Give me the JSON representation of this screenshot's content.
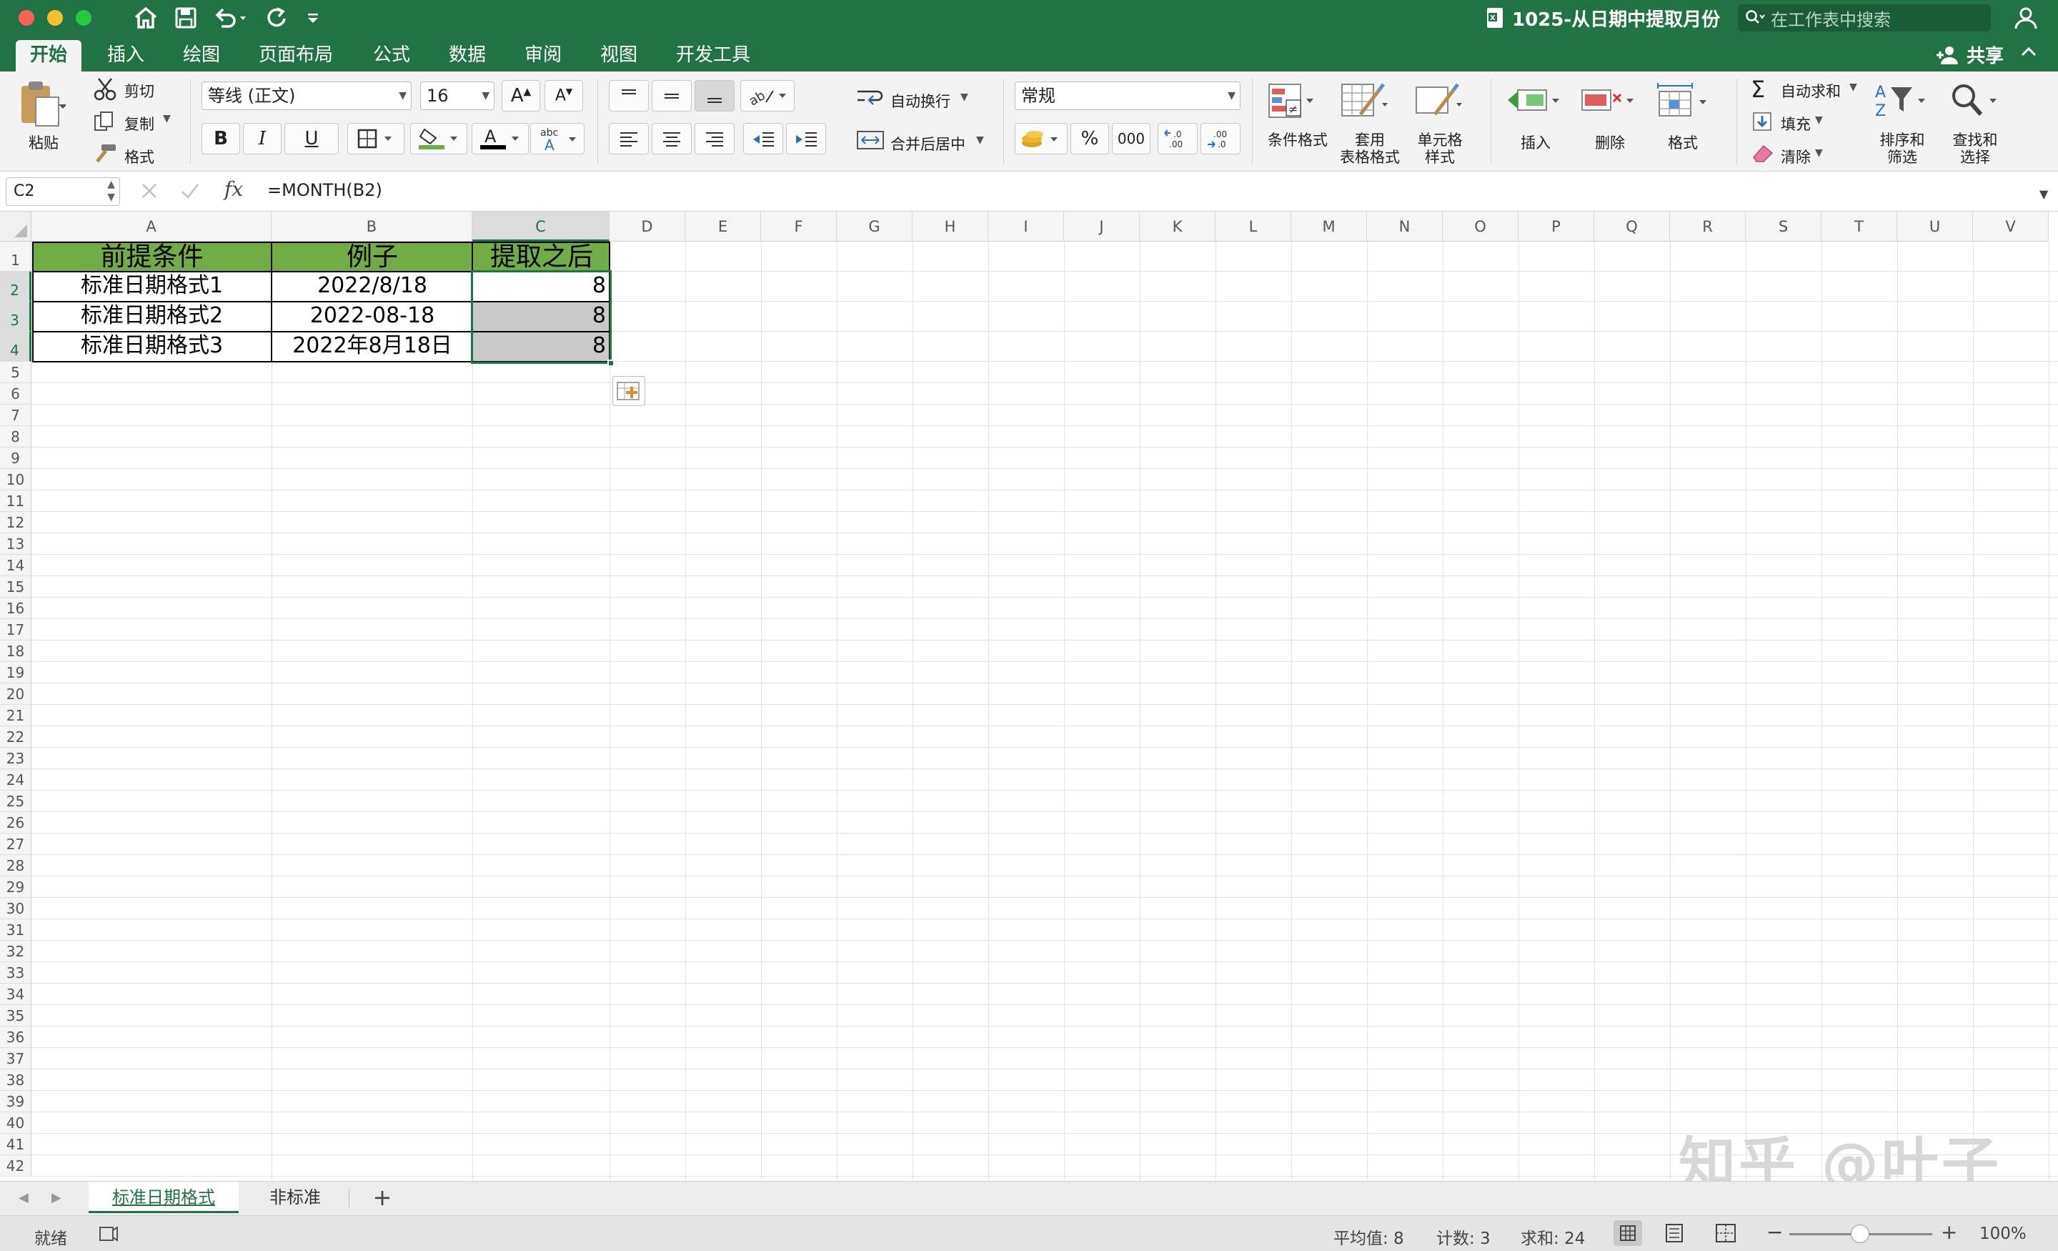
{
  "window": {
    "title": "1025-从日期中提取月份",
    "search_placeholder": "在工作表中搜索",
    "share": "共享"
  },
  "colors": {
    "brand": "#217346",
    "header_fill": "#70ad47",
    "selection": "#217346"
  },
  "ribbon_tabs": [
    "开始",
    "插入",
    "绘图",
    "页面布局",
    "公式",
    "数据",
    "审阅",
    "视图",
    "开发工具"
  ],
  "ribbon": {
    "paste": "粘贴",
    "cut": "剪切",
    "copy": "复制",
    "format_painter": "格式",
    "font_name": "等线 (正文)",
    "font_size": "16",
    "bold": "B",
    "italic": "I",
    "underline": "U",
    "wrap_text": "自动换行",
    "merge_center": "合并后居中",
    "number_format": "常规",
    "percent": "%",
    "comma": "000",
    "conditional_format_l1": "条件格式",
    "table_format_l1": "套用",
    "table_format_l2": "表格格式",
    "cell_style_l1": "单元格",
    "cell_style_l2": "样式",
    "insert": "插入",
    "delete": "删除",
    "format": "格式",
    "autosum": "自动求和",
    "fill": "填充",
    "clear": "清除",
    "sort_l1": "排序和",
    "sort_l2": "筛选",
    "find_l1": "查找和",
    "find_l2": "选择"
  },
  "formula_bar": {
    "name_box": "C2",
    "fx": "fx",
    "formula": "=MONTH(B2)"
  },
  "columns": [
    "A",
    "B",
    "C",
    "D",
    "E",
    "F",
    "G",
    "H",
    "I",
    "J",
    "K",
    "L",
    "M",
    "N",
    "O",
    "P",
    "Q",
    "R",
    "S",
    "T",
    "U",
    "V"
  ],
  "rows": [
    "1",
    "2",
    "3",
    "4",
    "5",
    "6",
    "7",
    "8",
    "9",
    "10",
    "11",
    "12",
    "13",
    "14",
    "15",
    "16",
    "17",
    "18",
    "19",
    "20",
    "21",
    "22",
    "23",
    "24",
    "25",
    "26",
    "27",
    "28",
    "29",
    "30",
    "31",
    "32",
    "33",
    "34",
    "35",
    "36",
    "37",
    "38",
    "39",
    "40",
    "41",
    "42"
  ],
  "table": {
    "headers": [
      "前提条件",
      "例子",
      "提取之后"
    ],
    "rows": [
      [
        "标准日期格式1",
        "2022/8/18",
        "8"
      ],
      [
        "标准日期格式2",
        "2022-08-18",
        "8"
      ],
      [
        "标准日期格式3",
        "2022年8月18日",
        "8"
      ]
    ]
  },
  "watermark": "知乎 @叶子",
  "sheets": [
    "标准日期格式",
    "非标准"
  ],
  "add_sheet": "+",
  "status": {
    "ready": "就绪",
    "average": "平均值: 8",
    "count": "计数: 3",
    "sum": "求和: 24",
    "zoom": "100%"
  }
}
